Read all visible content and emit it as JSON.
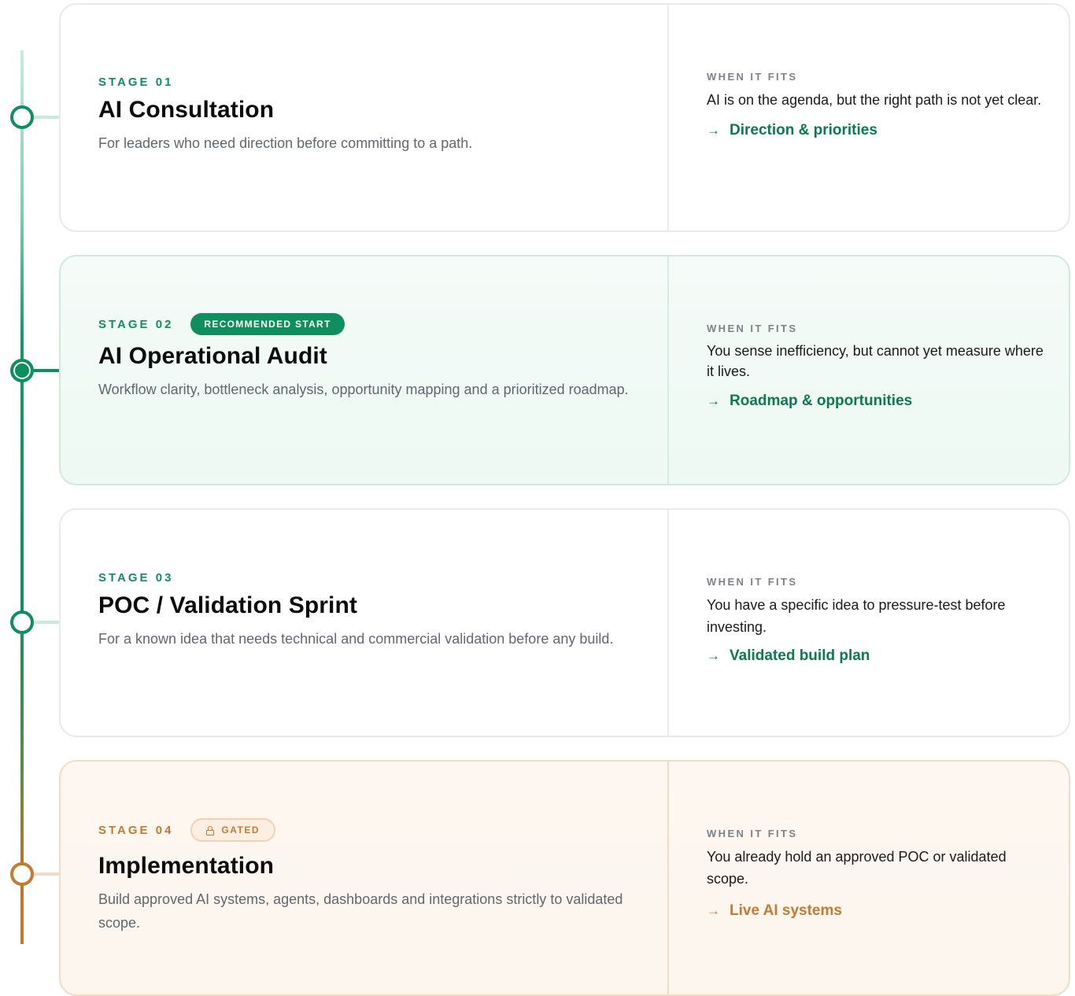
{
  "stages": [
    {
      "label": "STAGE 01",
      "title": "AI Consultation",
      "description": "For leaders who need direction before committing to a path.",
      "fits_label": "WHEN IT FITS",
      "fits_text": "AI is on the agenda, but the right path is not yet clear.",
      "outcome": "Direction & priorities"
    },
    {
      "label": "STAGE 02",
      "badge": "RECOMMENDED START",
      "title": "AI Operational Audit",
      "description": "Workflow clarity, bottleneck analysis, opportunity mapping and a prioritized roadmap.",
      "fits_label": "WHEN IT FITS",
      "fits_text": "You sense inefficiency, but cannot yet measure where it lives.",
      "outcome": "Roadmap & opportunities"
    },
    {
      "label": "STAGE 03",
      "title": "POC / Validation Sprint",
      "description": "For a known idea that needs technical and commercial validation before any build.",
      "fits_label": "WHEN IT FITS",
      "fits_text": "You have a specific idea to pressure-test before investing.",
      "outcome": "Validated build plan"
    },
    {
      "label": "STAGE 04",
      "badge": "GATED",
      "title": "Implementation",
      "description": "Build approved AI systems, agents, dashboards and integrations strictly to validated scope.",
      "fits_label": "WHEN IT FITS",
      "fits_text": "You already hold an approved POC or validated scope.",
      "outcome": "Live AI systems"
    }
  ],
  "arrow_glyph": "→",
  "colors": {
    "accent_green": "#0f8f5f",
    "accent_orange": "#c47a33",
    "mint_bg": "#f4fbf8",
    "cream_bg": "#fdf7f1"
  },
  "icons": {
    "gated_badge": "lock-icon",
    "outcome": "arrow-right-icon"
  }
}
